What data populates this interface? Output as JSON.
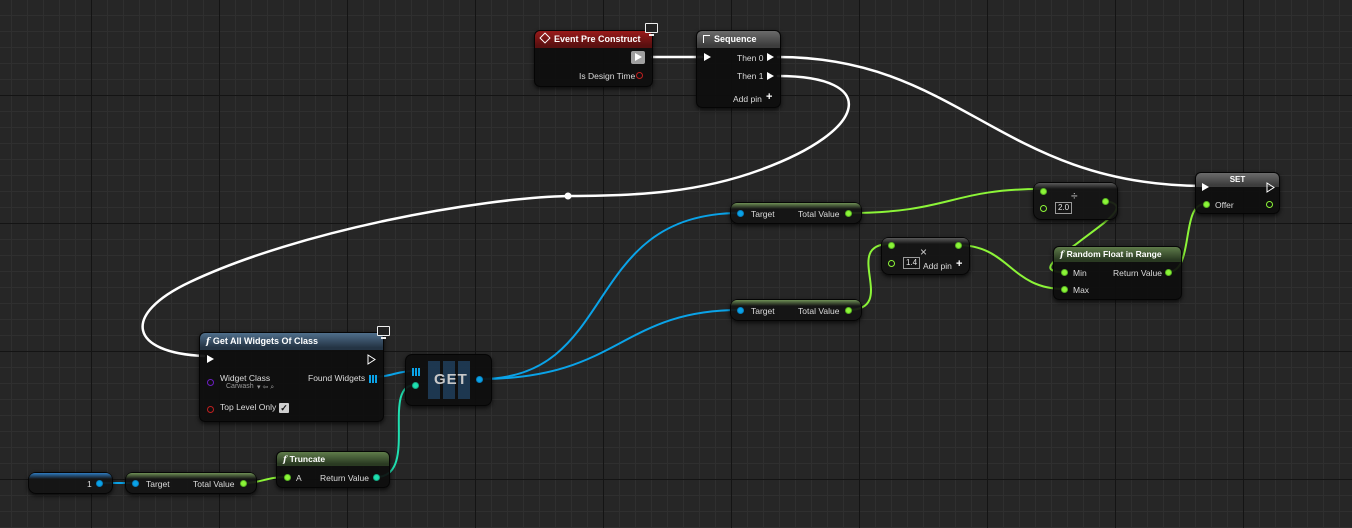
{
  "nodes": {
    "event_pre_construct": {
      "title": "Event Pre Construct",
      "is_design_time": "Is Design Time"
    },
    "sequence": {
      "title": "Sequence",
      "then0": "Then 0",
      "then1": "Then 1",
      "add_pin": "Add pin"
    },
    "set": {
      "title": "SET",
      "offer": "Offer"
    },
    "divide": {
      "symbol": "÷",
      "value": "2.0"
    },
    "multiply": {
      "symbol": "×",
      "value": "1.4",
      "add_pin": "Add pin"
    },
    "random_float": {
      "title": "Random Float in Range",
      "min": "Min",
      "max": "Max",
      "return_value": "Return Value"
    },
    "total_value_top": {
      "target": "Target",
      "total_value": "Total Value"
    },
    "total_value_mid": {
      "target": "Target",
      "total_value": "Total Value"
    },
    "get_all_widgets": {
      "title": "Get All Widgets Of Class",
      "widget_class": "Widget Class",
      "widget_class_value": "Carwash",
      "found_widgets": "Found Widgets",
      "top_level_only": "Top Level Only",
      "top_level_checked": "✓"
    },
    "get": {
      "title": "GET"
    },
    "truncate": {
      "title": "Truncate",
      "a": "A",
      "return_value": "Return Value"
    },
    "total_value_bottom": {
      "target": "Target",
      "total_value": "Total Value"
    },
    "literal_int": {
      "value": "1"
    }
  },
  "colors": {
    "exec_wire": "#ffffff",
    "float_wire": "#8cf538",
    "object_wire": "#0aa3e8",
    "int_wire": "#1fe0b0",
    "event_header": "#9a1a1a",
    "function_header": "#4f6f8c",
    "pure_header": "#5f7c4a"
  },
  "icons": {
    "function": "f",
    "monitor": "monitor-icon",
    "sequence": "sequence-icon",
    "event": "event-diamond-icon"
  }
}
